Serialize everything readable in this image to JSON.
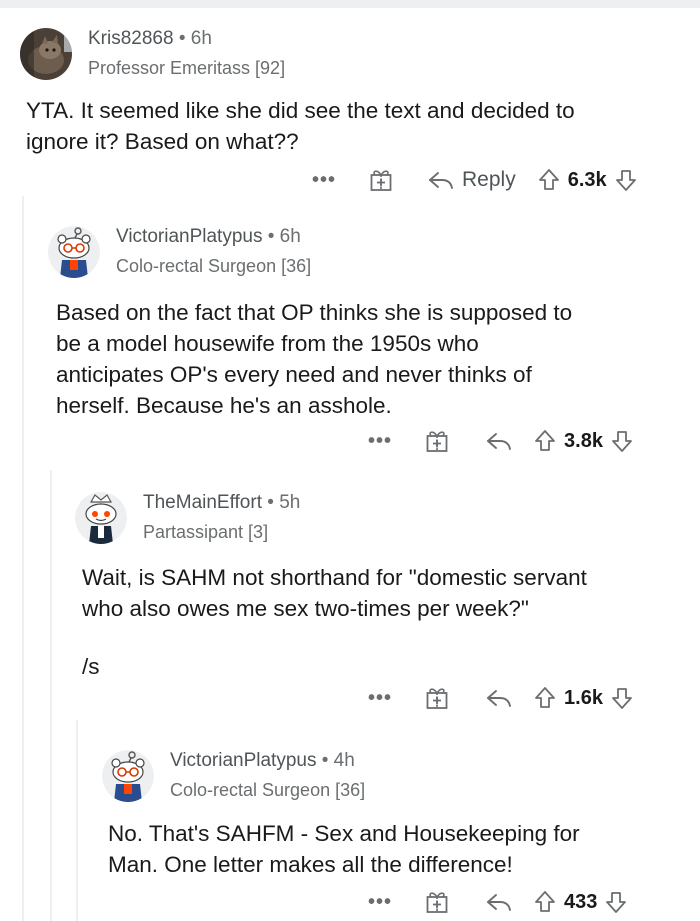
{
  "comments": [
    {
      "username": "Kris82868",
      "separator": "•",
      "time": "6h",
      "flair": "Professor Emeritass [92]",
      "body": "YTA. It seemed like she did see the text and decided to\nignore it? Based on what??",
      "more": "•••",
      "reply_label": "Reply",
      "votes": "6.3k",
      "avatar": "cat-photo-avatar"
    },
    {
      "username": "VictorianPlatypus",
      "separator": "•",
      "time": "6h",
      "flair": "Colo-rectal Surgeon [36]",
      "body": "Based on the fact that OP thinks she is supposed to\nbe a model housewife from the 1950s who\nanticipates OP's every need and never thinks of\nherself. Because he's an asshole.",
      "more": "•••",
      "votes": "3.8k",
      "avatar": "snoo-avatar"
    },
    {
      "username": "TheMainEffort",
      "separator": "•",
      "time": "5h",
      "flair": "Partassipant [3]",
      "body": "Wait, is SAHM not shorthand for \"domestic servant\nwho also owes me sex two-times per week?\"",
      "body2": "/s",
      "more": "•••",
      "votes": "1.6k",
      "avatar": "snoo-avatar"
    },
    {
      "username": "VictorianPlatypus",
      "separator": "•",
      "time": "4h",
      "flair": "Colo-rectal Surgeon [36]",
      "body": "No. That's SAHFM - Sex and Housekeeping for\nMan. One letter makes all the difference!",
      "more": "•••",
      "votes": "433",
      "avatar": "snoo-avatar"
    }
  ],
  "colors": {
    "text": "#1a1a1b",
    "meta": "#6b6e70",
    "thread_line": "#edeff1",
    "snoo_orange": "#ff4500"
  }
}
